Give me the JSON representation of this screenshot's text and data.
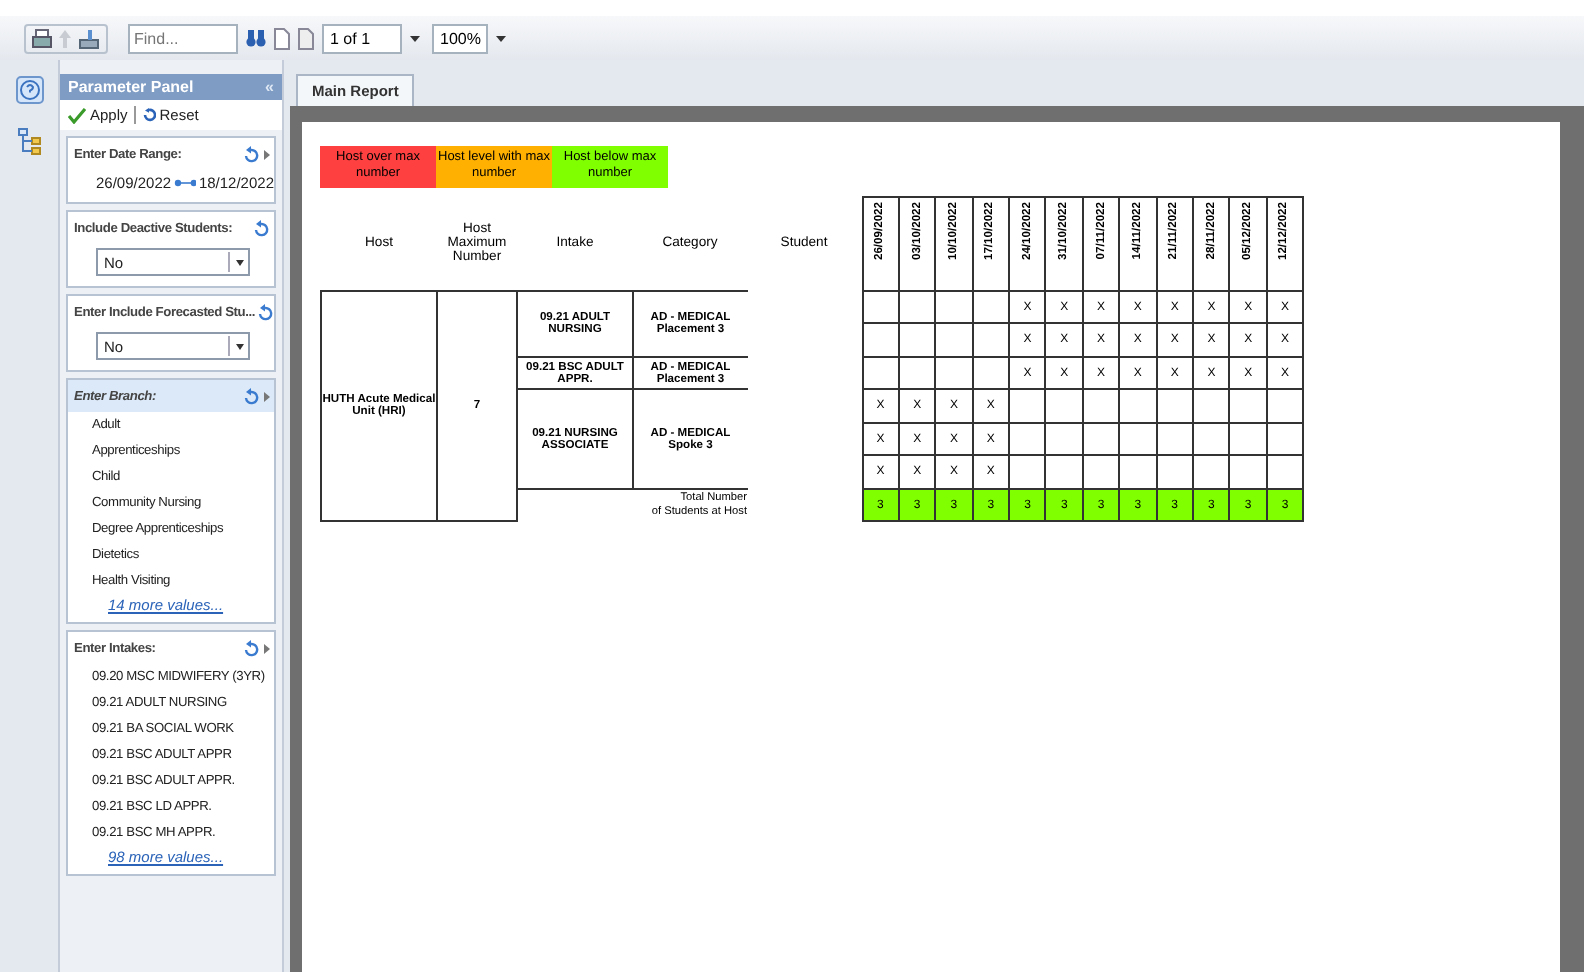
{
  "toolbar": {
    "find_placeholder": "Find...",
    "page": "1 of 1",
    "zoom": "100%"
  },
  "parameter_panel": {
    "title": "Parameter Panel",
    "collapse": "«",
    "actions": [
      {
        "kind": "apply",
        "label": "Apply"
      },
      {
        "kind": "reset",
        "label": "Reset"
      }
    ],
    "parameters": [
      {
        "kind": "range",
        "label": "Enter Date Range:",
        "from": "26/09/2022",
        "to": "18/12/2022",
        "expandable": true,
        "selected": false
      },
      {
        "kind": "dropdown",
        "label": "Include Deactive Students:",
        "value": "No",
        "expandable": false,
        "selected": false
      },
      {
        "kind": "dropdown",
        "label": "Enter Include Forecasted Stu...",
        "value": "No",
        "expandable": false,
        "selected": false
      },
      {
        "kind": "list",
        "label": "Enter Branch:",
        "values": [
          "Adult",
          "Apprenticeships",
          "Child",
          "Community Nursing",
          "Degree Apprenticeships",
          "Dietetics",
          "Health Visiting"
        ],
        "more": "14 more values...",
        "expandable": true,
        "selected": true
      },
      {
        "kind": "list",
        "label": "Enter Intakes:",
        "values": [
          "09.20 MSC MIDWIFERY (3YR)",
          "09.21 ADULT NURSING",
          "09.21 BA SOCIAL WORK",
          "09.21 BSC ADULT APPR",
          "09.21 BSC ADULT APPR.",
          "09.21 BSC LD APPR.",
          "09.21 BSC MH APPR."
        ],
        "more": "98 more values...",
        "expandable": true,
        "selected": false
      }
    ]
  },
  "tabs": [
    {
      "label": "Main Report",
      "selected": true
    }
  ],
  "report": {
    "legend": [
      {
        "label": "Host over max number",
        "color": "#ff4040"
      },
      {
        "label": "Host level with max number",
        "color": "#ffb000"
      },
      {
        "label": "Host below max number",
        "color": "#80ff00"
      }
    ],
    "columns": {
      "host": "Host",
      "max": "Host Maximum Number",
      "intake": "Intake",
      "category": "Category",
      "student": "Student",
      "dates": [
        "26/09/2022",
        "03/10/2022",
        "10/10/2022",
        "17/10/2022",
        "24/10/2022",
        "31/10/2022",
        "07/11/2022",
        "14/11/2022",
        "21/11/2022",
        "28/11/2022",
        "05/12/2022",
        "12/12/2022"
      ]
    },
    "host": "HUTH Acute Medical Unit (HRI)",
    "max": "7",
    "groups": [
      {
        "intake": "09.21 ADULT NURSING",
        "category": "AD - MEDICAL\nPlacement 3",
        "rows": [
          {
            "cells": [
              null,
              null,
              null,
              null,
              "X",
              "X",
              "X",
              "X",
              "X",
              "X",
              "X",
              "X"
            ]
          },
          {
            "cells": [
              null,
              null,
              null,
              null,
              "X",
              "X",
              "X",
              "X",
              "X",
              "X",
              "X",
              "X"
            ]
          }
        ]
      },
      {
        "intake": "09.21 BSC ADULT APPR.",
        "category": "AD - MEDICAL\nPlacement 3",
        "rows": [
          {
            "cells": [
              null,
              null,
              null,
              null,
              "X",
              "X",
              "X",
              "X",
              "X",
              "X",
              "X",
              "X"
            ]
          }
        ]
      },
      {
        "intake": "09.21 NURSING ASSOCIATE",
        "category": "AD - MEDICAL\nSpoke 3",
        "rows": [
          {
            "cells": [
              "X",
              "X",
              "X",
              "X",
              null,
              null,
              null,
              null,
              null,
              null,
              null,
              null
            ]
          },
          {
            "cells": [
              "X",
              "X",
              "X",
              "X",
              null,
              null,
              null,
              null,
              null,
              null,
              null,
              null
            ]
          },
          {
            "cells": [
              "X",
              "X",
              "X",
              "X",
              null,
              null,
              null,
              null,
              null,
              null,
              null,
              null
            ]
          }
        ]
      }
    ],
    "total_label": "Total Number\nof Students at Host",
    "totals": [
      {
        "value": "3",
        "color": "#80ff00"
      },
      {
        "value": "3",
        "color": "#80ff00"
      },
      {
        "value": "3",
        "color": "#80ff00"
      },
      {
        "value": "3",
        "color": "#80ff00"
      },
      {
        "value": "3",
        "color": "#80ff00"
      },
      {
        "value": "3",
        "color": "#80ff00"
      },
      {
        "value": "3",
        "color": "#80ff00"
      },
      {
        "value": "3",
        "color": "#80ff00"
      },
      {
        "value": "3",
        "color": "#80ff00"
      },
      {
        "value": "3",
        "color": "#80ff00"
      },
      {
        "value": "3",
        "color": "#80ff00"
      },
      {
        "value": "3",
        "color": "#80ff00"
      }
    ]
  }
}
